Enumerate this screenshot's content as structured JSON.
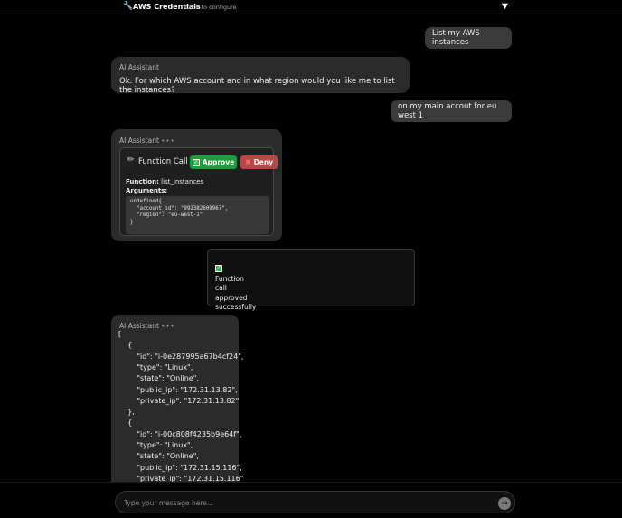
{
  "header": {
    "icon": "wrench-icon",
    "title": "AWS Credentials",
    "hint": "Click to configure",
    "toggle_icon": "triangle-down-icon"
  },
  "messages": {
    "user1": "List my AWS instances",
    "ai1": {
      "label": "AI Assistant",
      "text": "Ok. For which AWS account and in what region would you like me to list the instances?"
    },
    "user2": "on my main accout for eu west 1",
    "ai2": {
      "label": "AI Assistant",
      "dots": "•••",
      "function_call": {
        "title": "Function Call",
        "approve_label": "Approve",
        "deny_label": "Deny",
        "function_label": "Function:",
        "function_name": "list_instances",
        "arguments_label": "Arguments:",
        "code": "undefined{\n  \"account_id\": \"992382609967\",\n  \"region\": \"eu-west-1\"\n}"
      }
    },
    "system": {
      "lines": [
        "Function",
        "call",
        "approved",
        "successfully"
      ]
    },
    "ai3": {
      "label": "AI Assistant",
      "dots": "•••",
      "json_lines": [
        "[",
        "    {",
        "        \"id\": \"i-0e287995a67b4cf24\",",
        "        \"type\": \"Linux\",",
        "        \"state\": \"Online\",",
        "        \"public_ip\": \"172.31.13.82\",",
        "        \"private_ip\": \"172.31.13.82\"",
        "    },",
        "    {",
        "        \"id\": \"i-00c808f4235b9e64f\",",
        "        \"type\": \"Linux\",",
        "        \"state\": \"Online\",",
        "        \"public_ip\": \"172.31.15.116\",",
        "        \"private_ip\": \"172.31.15.116\""
      ]
    }
  },
  "composer": {
    "placeholder": "Type your message here...",
    "send_icon": "arrow-right-icon"
  },
  "colors": {
    "approve": "#1d9d3c",
    "deny": "#b8474a",
    "user_bubble": "#3a3a3a",
    "ai_bubble": "#2b2b2b"
  }
}
